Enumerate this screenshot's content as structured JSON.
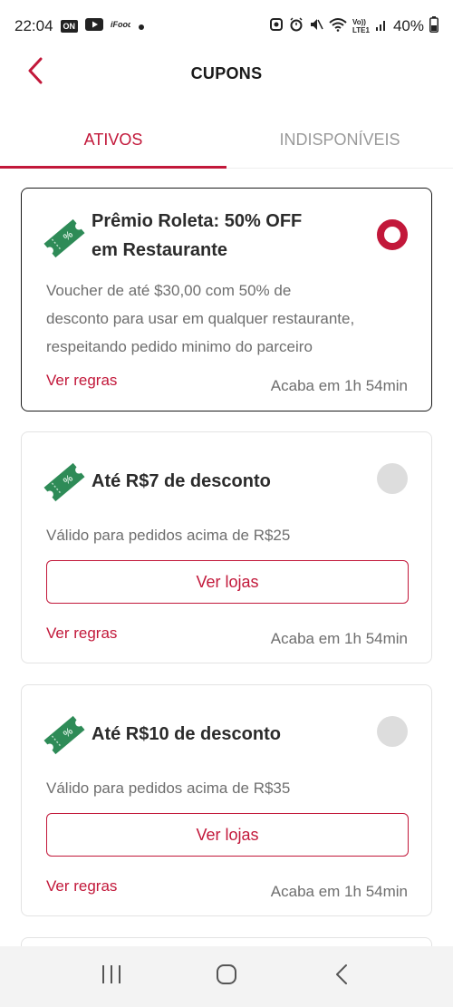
{
  "status_bar": {
    "time": "22:04",
    "battery": "40%",
    "network_label": "LTE1",
    "volte_label": "Vo))"
  },
  "header": {
    "title": "CUPONS"
  },
  "tabs": [
    {
      "label": "ATIVOS",
      "active": true
    },
    {
      "label": "INDISPONÍVEIS",
      "active": false
    }
  ],
  "coupons": [
    {
      "title_line1": "Prêmio Roleta: 50% OFF",
      "title_line2": "em Restaurante",
      "description": [
        "Voucher de até $30,00 com 50% de",
        "desconto para usar em qualquer restaurante,",
        "respeitando pedido minimo do parceiro"
      ],
      "rules_label": "Ver regras",
      "expiry": "Acaba em 1h 54min",
      "selected": true
    },
    {
      "title_line1": "Até R$7 de desconto",
      "description": [
        "Válido para pedidos acima de R$25"
      ],
      "button_label": "Ver lojas",
      "rules_label": "Ver regras",
      "expiry": "Acaba em 1h 54min",
      "selected": false
    },
    {
      "title_line1": "Até R$10 de desconto",
      "description": [
        "Válido para pedidos acima de R$35"
      ],
      "button_label": "Ver lojas",
      "rules_label": "Ver regras",
      "expiry": "Acaba em 1h 54min",
      "selected": false
    }
  ],
  "colors": {
    "accent": "#c2183a",
    "ticket_green": "#2e8b57",
    "radio_off": "#dddddd"
  },
  "icons": {
    "back": "chevron-left-icon",
    "coupon": "coupon-ticket-icon",
    "nav_recents": "recents-icon",
    "nav_home": "home-icon",
    "nav_back": "back-icon"
  }
}
